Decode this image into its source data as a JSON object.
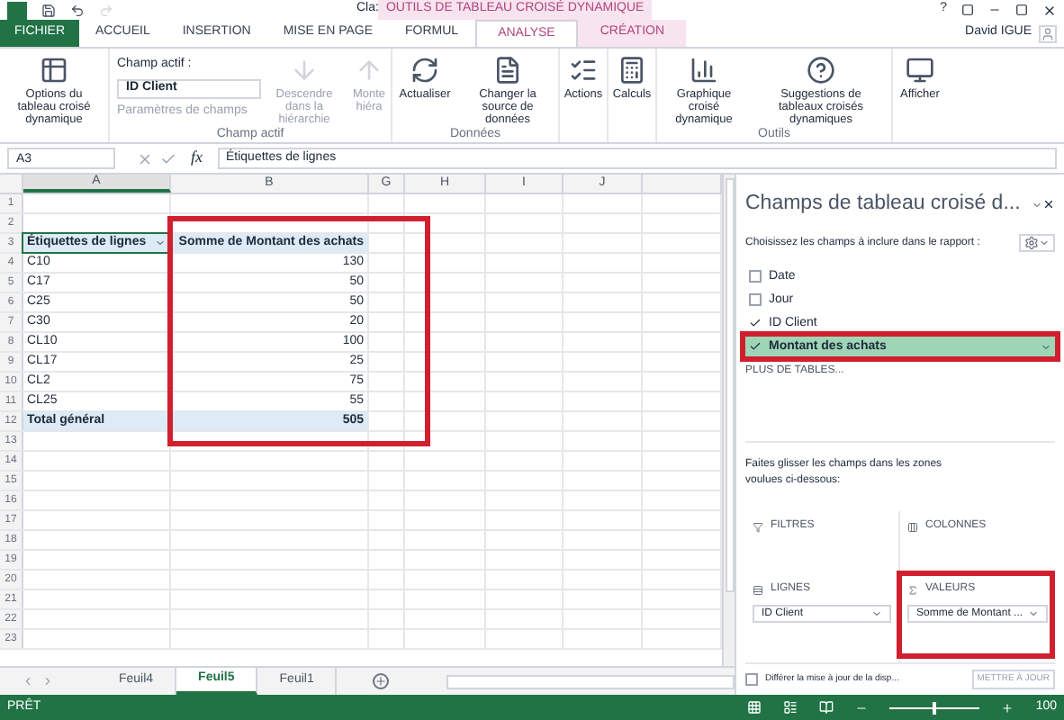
{
  "title_bar": {
    "title": "Cla:",
    "context_title": "OUTILS DE TABLEAU CROISÉ DYNAMIQUE",
    "help": "?"
  },
  "tabs": [
    {
      "label": "FICHIER",
      "kind": "file",
      "selected": false
    },
    {
      "label": "ACCUEIL",
      "kind": "normal",
      "selected": false
    },
    {
      "label": "INSERTION",
      "kind": "normal",
      "selected": false
    },
    {
      "label": "MISE EN PAGE",
      "kind": "normal",
      "selected": false
    },
    {
      "label": "FORMUL",
      "kind": "normal",
      "selected": false
    },
    {
      "label": "ANALYSE",
      "kind": "context",
      "selected": true
    },
    {
      "label": "CRÉATION",
      "kind": "context",
      "selected": false
    }
  ],
  "user": "David IGUE",
  "ribbon": {
    "options": "Options du tableau croisé dynamique",
    "active_field": {
      "label": "Champ actif :",
      "value": "ID Client",
      "settings": "Paramètres de champs",
      "settings_disabled": true
    },
    "drill_down": {
      "label": "Descendre dans la hiérarchie",
      "disabled": true
    },
    "drill_up": {
      "label": "Monte hiéra",
      "disabled": true
    },
    "active_group": "Champ actif",
    "refresh": "Actualiser",
    "change_source": "Changer la source de données",
    "data_group": "Données",
    "actions": "Actions",
    "calculations": "Calculs",
    "pivot_chart": "Graphique croisé dynamique",
    "recommended": "Suggestions de tableaux croisés dynamiques",
    "tools_group": "Outils",
    "show": "Afficher"
  },
  "formula_bar": {
    "name_box": "A3",
    "function": "fx",
    "formula": "Étiquettes de lignes"
  },
  "columns": [
    "A",
    "B",
    "G",
    "H",
    "I",
    "J"
  ],
  "rows": [
    {
      "number": "1",
      "a": "",
      "b": "",
      "kind": "empty"
    },
    {
      "number": "2",
      "a": "",
      "b": "",
      "kind": "empty"
    },
    {
      "number": "3",
      "a": "Étiquettes de lignes",
      "b": "Somme de Montant des achats",
      "kind": "header"
    },
    {
      "number": "4",
      "a": "C10",
      "b": "130",
      "kind": "item"
    },
    {
      "number": "5",
      "a": "C17",
      "b": "50",
      "kind": "item"
    },
    {
      "number": "6",
      "a": "C25",
      "b": "50",
      "kind": "item"
    },
    {
      "number": "7",
      "a": "C30",
      "b": "20",
      "kind": "item"
    },
    {
      "number": "8",
      "a": "CL10",
      "b": "100",
      "kind": "item"
    },
    {
      "number": "9",
      "a": "CL17",
      "b": "25",
      "kind": "item"
    },
    {
      "number": "10",
      "a": "CL2",
      "b": "75",
      "kind": "item"
    },
    {
      "number": "11",
      "a": "CL25",
      "b": "55",
      "kind": "item"
    },
    {
      "number": "12",
      "a": "Total général",
      "b": "505",
      "kind": "total"
    },
    {
      "number": "13",
      "a": "",
      "b": "",
      "kind": "empty"
    },
    {
      "number": "14",
      "a": "",
      "b": "",
      "kind": "empty"
    },
    {
      "number": "15",
      "a": "",
      "b": "",
      "kind": "empty"
    },
    {
      "number": "16",
      "a": "",
      "b": "",
      "kind": "empty"
    },
    {
      "number": "17",
      "a": "",
      "b": "",
      "kind": "empty"
    },
    {
      "number": "18",
      "a": "",
      "b": "",
      "kind": "empty"
    },
    {
      "number": "19",
      "a": "",
      "b": "",
      "kind": "empty"
    },
    {
      "number": "20",
      "a": "",
      "b": "",
      "kind": "empty"
    },
    {
      "number": "21",
      "a": "",
      "b": "",
      "kind": "empty"
    },
    {
      "number": "22",
      "a": "",
      "b": "",
      "kind": "empty"
    },
    {
      "number": "23",
      "a": "",
      "b": "",
      "kind": "empty"
    }
  ],
  "sheets": [
    {
      "label": "Feuil4",
      "selected": false
    },
    {
      "label": "Feuil5",
      "selected": true
    },
    {
      "label": "Feuil1",
      "selected": false
    }
  ],
  "status": {
    "text": "PRÊT",
    "zoom": "100",
    "zoom_slider": {
      "level": 0.5
    }
  },
  "pane": {
    "title": "Champs de tableau croisé d...",
    "subtitle": "Choisissez les champs à inclure dans le rapport :",
    "fields": [
      {
        "label": "Date",
        "checked": false,
        "selected": false
      },
      {
        "label": "Jour",
        "checked": false,
        "selected": false
      },
      {
        "label": "ID Client",
        "checked": true,
        "selected": false
      },
      {
        "label": "Montant des achats",
        "checked": true,
        "selected": true
      }
    ],
    "more_tables": "PLUS DE TABLES...",
    "instruction": "Faites glisser les champs dans les zones voulues ci-dessous:",
    "areas": [
      {
        "label": "FILTRES",
        "kind": "filter"
      },
      {
        "label": "COLONNES",
        "kind": "columns"
      },
      {
        "label": "LIGNES",
        "kind": "rows",
        "items": [
          "ID Client"
        ]
      },
      {
        "label": "VALEURS",
        "kind": "values",
        "items": [
          "Somme de Montant ..."
        ]
      }
    ],
    "defer": {
      "label": "Différer la mise à jour de la disp...",
      "checked": false
    },
    "update": {
      "label": "METTRE À JOUR",
      "disabled": true
    }
  }
}
